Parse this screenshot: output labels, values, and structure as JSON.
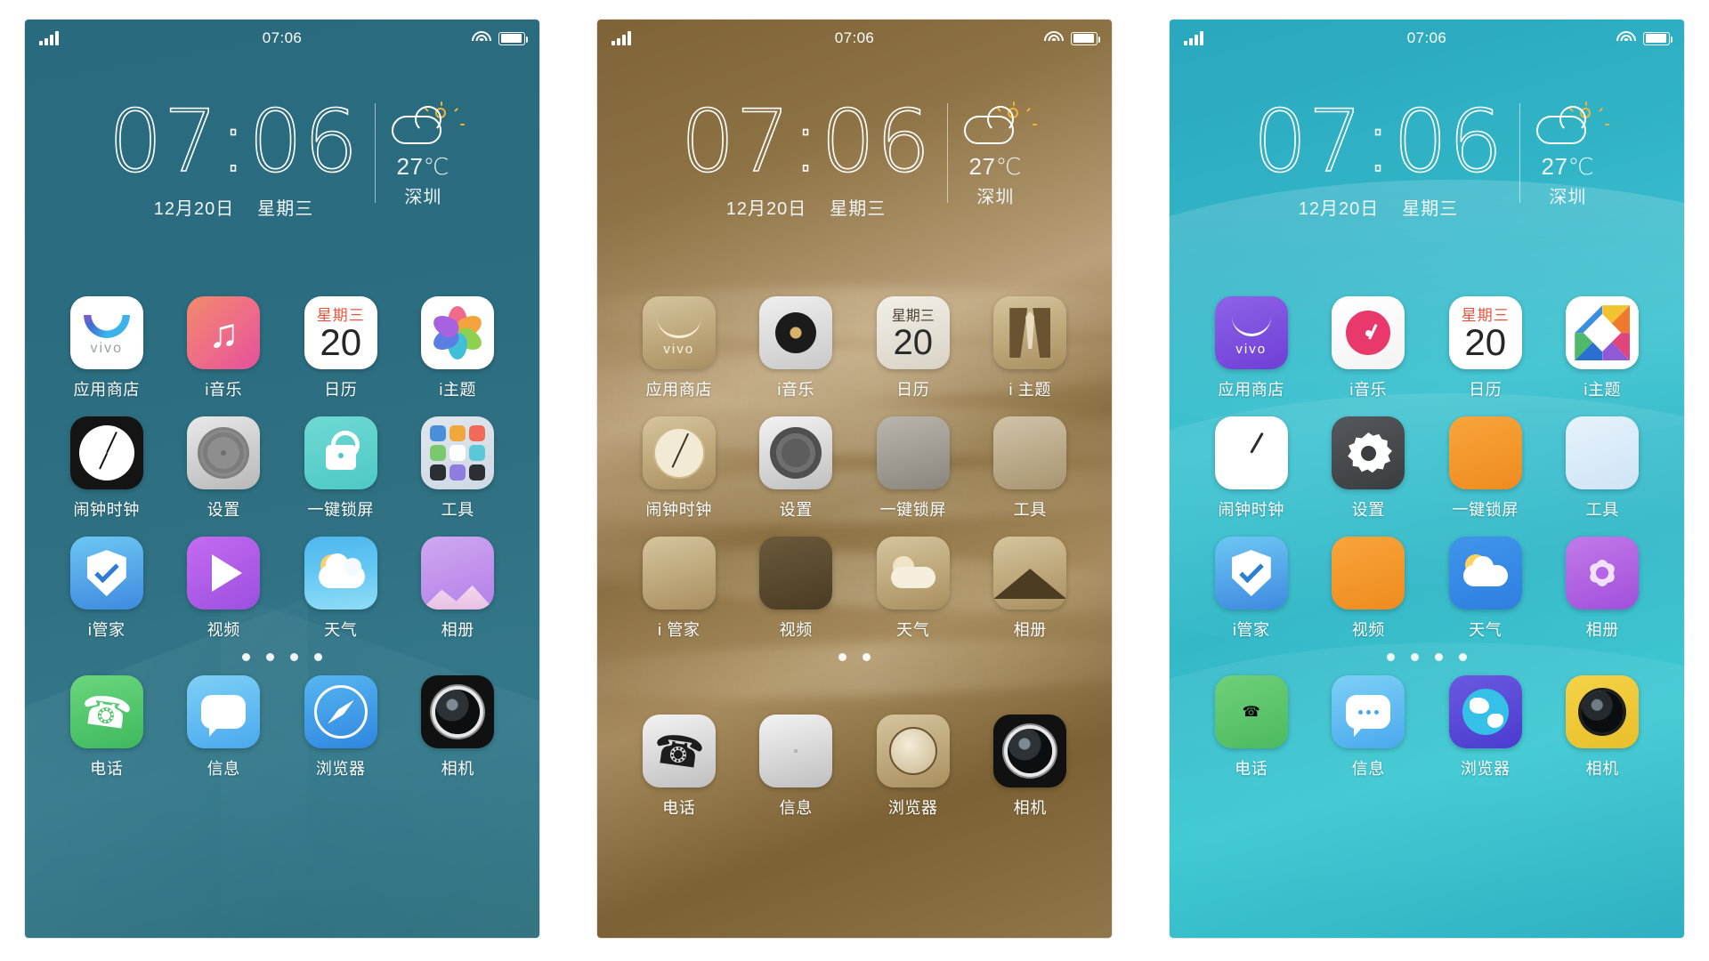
{
  "status_bar": {
    "signal_icon": "signal-bars-icon",
    "time": "07:06",
    "wifi_icon": "wifi-icon",
    "battery_icon": "battery-icon"
  },
  "clock_widget": {
    "hours": "07",
    "separator": ":",
    "minutes": "06",
    "date": "12月20日",
    "weekday": "星期三",
    "weather_icon": "partly-cloudy-icon",
    "temperature": "27℃",
    "city": "深圳"
  },
  "panels": [
    {
      "id": "panel-teal",
      "theme_name": "teal",
      "accent": "#2f7183",
      "page_dots": 4,
      "active_dot": 1,
      "apps": [
        {
          "label": "应用商店",
          "icon": "vivo-app-store-icon"
        },
        {
          "label": "i音乐",
          "icon": "music-icon"
        },
        {
          "label": "日历",
          "icon": "calendar-icon"
        },
        {
          "label": "i主题",
          "icon": "theme-icon"
        },
        {
          "label": "闹钟时钟",
          "icon": "clock-icon"
        },
        {
          "label": "设置",
          "icon": "settings-gear-icon"
        },
        {
          "label": "一键锁屏",
          "icon": "lock-icon"
        },
        {
          "label": "工具",
          "icon": "tools-folder-icon"
        },
        {
          "label": "i管家",
          "icon": "shield-check-icon"
        },
        {
          "label": "视频",
          "icon": "video-play-icon"
        },
        {
          "label": "天气",
          "icon": "weather-icon"
        },
        {
          "label": "相册",
          "icon": "gallery-icon"
        }
      ],
      "dock": [
        {
          "label": "电话",
          "icon": "phone-icon"
        },
        {
          "label": "信息",
          "icon": "message-icon"
        },
        {
          "label": "浏览器",
          "icon": "browser-compass-icon"
        },
        {
          "label": "相机",
          "icon": "camera-icon"
        }
      ],
      "calendar": {
        "weekday": "星期三",
        "day": "20"
      }
    },
    {
      "id": "panel-gold",
      "theme_name": "gold",
      "accent": "#8d7244",
      "page_dots": 2,
      "active_dot": 0,
      "apps": [
        {
          "label": "应用商店",
          "icon": "vivo-app-store-icon"
        },
        {
          "label": "i音乐",
          "icon": "music-vinyl-icon"
        },
        {
          "label": "日历",
          "icon": "calendar-icon"
        },
        {
          "label": "i 主题",
          "icon": "suit-theme-icon"
        },
        {
          "label": "闹钟时钟",
          "icon": "clock-icon"
        },
        {
          "label": "设置",
          "icon": "settings-gear-icon"
        },
        {
          "label": "一键锁屏",
          "icon": "lock-icon"
        },
        {
          "label": "工具",
          "icon": "tools-folder-icon"
        },
        {
          "label": "i 管家",
          "icon": "shield-check-icon"
        },
        {
          "label": "视频",
          "icon": "video-play-icon"
        },
        {
          "label": "天气",
          "icon": "weather-icon"
        },
        {
          "label": "相册",
          "icon": "gallery-mountain-icon"
        }
      ],
      "dock": [
        {
          "label": "电话",
          "icon": "phone-icon"
        },
        {
          "label": "信息",
          "icon": "message-icon"
        },
        {
          "label": "浏览器",
          "icon": "browser-globe-icon"
        },
        {
          "label": "相机",
          "icon": "camera-icon"
        }
      ],
      "calendar": {
        "weekday": "星期三",
        "day": "20"
      }
    },
    {
      "id": "panel-cyan",
      "theme_name": "cyan",
      "accent": "#31b3c6",
      "page_dots": 4,
      "active_dot": 1,
      "apps": [
        {
          "label": "应用商店",
          "icon": "vivo-app-store-icon"
        },
        {
          "label": "i音乐",
          "icon": "music-disc-icon"
        },
        {
          "label": "日历",
          "icon": "calendar-icon"
        },
        {
          "label": "i主题",
          "icon": "theme-diamond-icon"
        },
        {
          "label": "闹钟时钟",
          "icon": "clock-icon"
        },
        {
          "label": "设置",
          "icon": "settings-gear-icon"
        },
        {
          "label": "一键锁屏",
          "icon": "lock-icon"
        },
        {
          "label": "工具",
          "icon": "tools-folder-icon"
        },
        {
          "label": "i管家",
          "icon": "shield-check-icon"
        },
        {
          "label": "视频",
          "icon": "video-play-icon"
        },
        {
          "label": "天气",
          "icon": "weather-icon"
        },
        {
          "label": "相册",
          "icon": "gallery-flower-icon"
        }
      ],
      "dock": [
        {
          "label": "电话",
          "icon": "phone-icon"
        },
        {
          "label": "信息",
          "icon": "message-icon"
        },
        {
          "label": "浏览器",
          "icon": "browser-globe-icon"
        },
        {
          "label": "相机",
          "icon": "camera-icon"
        }
      ],
      "calendar": {
        "weekday": "星期三",
        "day": "20"
      }
    }
  ]
}
